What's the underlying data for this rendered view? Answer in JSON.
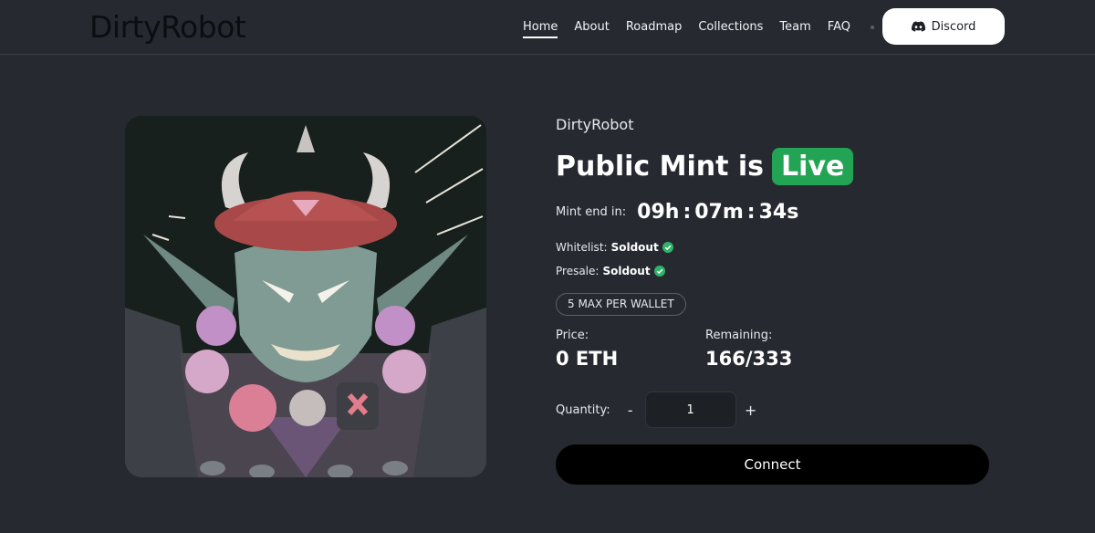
{
  "brand": {
    "logo_text": "DirtyRobot"
  },
  "nav": {
    "items": [
      {
        "label": "Home",
        "active": true
      },
      {
        "label": "About",
        "active": false
      },
      {
        "label": "Roadmap",
        "active": false
      },
      {
        "label": "Collections",
        "active": false
      },
      {
        "label": "Team",
        "active": false
      },
      {
        "label": "FAQ",
        "active": false
      }
    ],
    "discord_label": "Discord"
  },
  "mint": {
    "collection_name": "DirtyRobot",
    "headline_prefix": "Public Mint is",
    "live_label": "Live",
    "countdown_label": "Mint end in:",
    "countdown": {
      "hours": "09h",
      "minutes": "07m",
      "seconds": "34s"
    },
    "whitelist": {
      "label": "Whitelist:",
      "status": "Soldout"
    },
    "presale": {
      "label": "Presale:",
      "status": "Soldout"
    },
    "max_per_wallet": "5 MAX PER WALLET",
    "price": {
      "label": "Price:",
      "value": "0 ETH"
    },
    "remaining": {
      "label": "Remaining:",
      "value": "166/333"
    },
    "quantity": {
      "label": "Quantity:",
      "value": "1",
      "minus": "-",
      "plus": "+"
    },
    "connect_label": "Connect"
  },
  "colors": {
    "background": "#262a30",
    "live_green": "#23a455",
    "check_green": "#2fb36b",
    "connect_button": "#000000"
  },
  "icons": [
    "discord-icon",
    "check-circle-icon"
  ]
}
